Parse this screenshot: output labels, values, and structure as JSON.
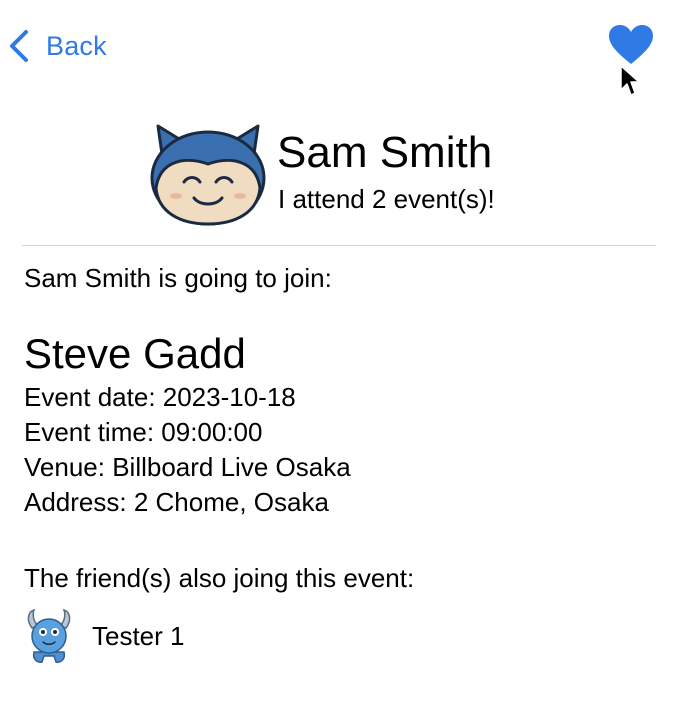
{
  "nav": {
    "back_label": "Back",
    "back_icon": "chevron-left-icon",
    "favorite_icon": "heart-icon",
    "accent_color": "#2f7ae5"
  },
  "profile": {
    "name": "Sam Smith",
    "subtitle": "I attend 2 event(s)!",
    "avatar_icon": "sleepy-cat-avatar"
  },
  "content": {
    "joining_heading": "Sam Smith is going to join:",
    "event": {
      "title": "Steve Gadd",
      "date": "Event date: 2023-10-18",
      "time": "Event time: 09:00:00",
      "venue": "Venue: Billboard Live Osaka",
      "address": "Address: 2 Chome, Osaka"
    },
    "friends_heading": "The friend(s) also joing this event:",
    "friends": [
      {
        "name": "Tester 1",
        "avatar_icon": "blue-monster-avatar"
      }
    ]
  }
}
